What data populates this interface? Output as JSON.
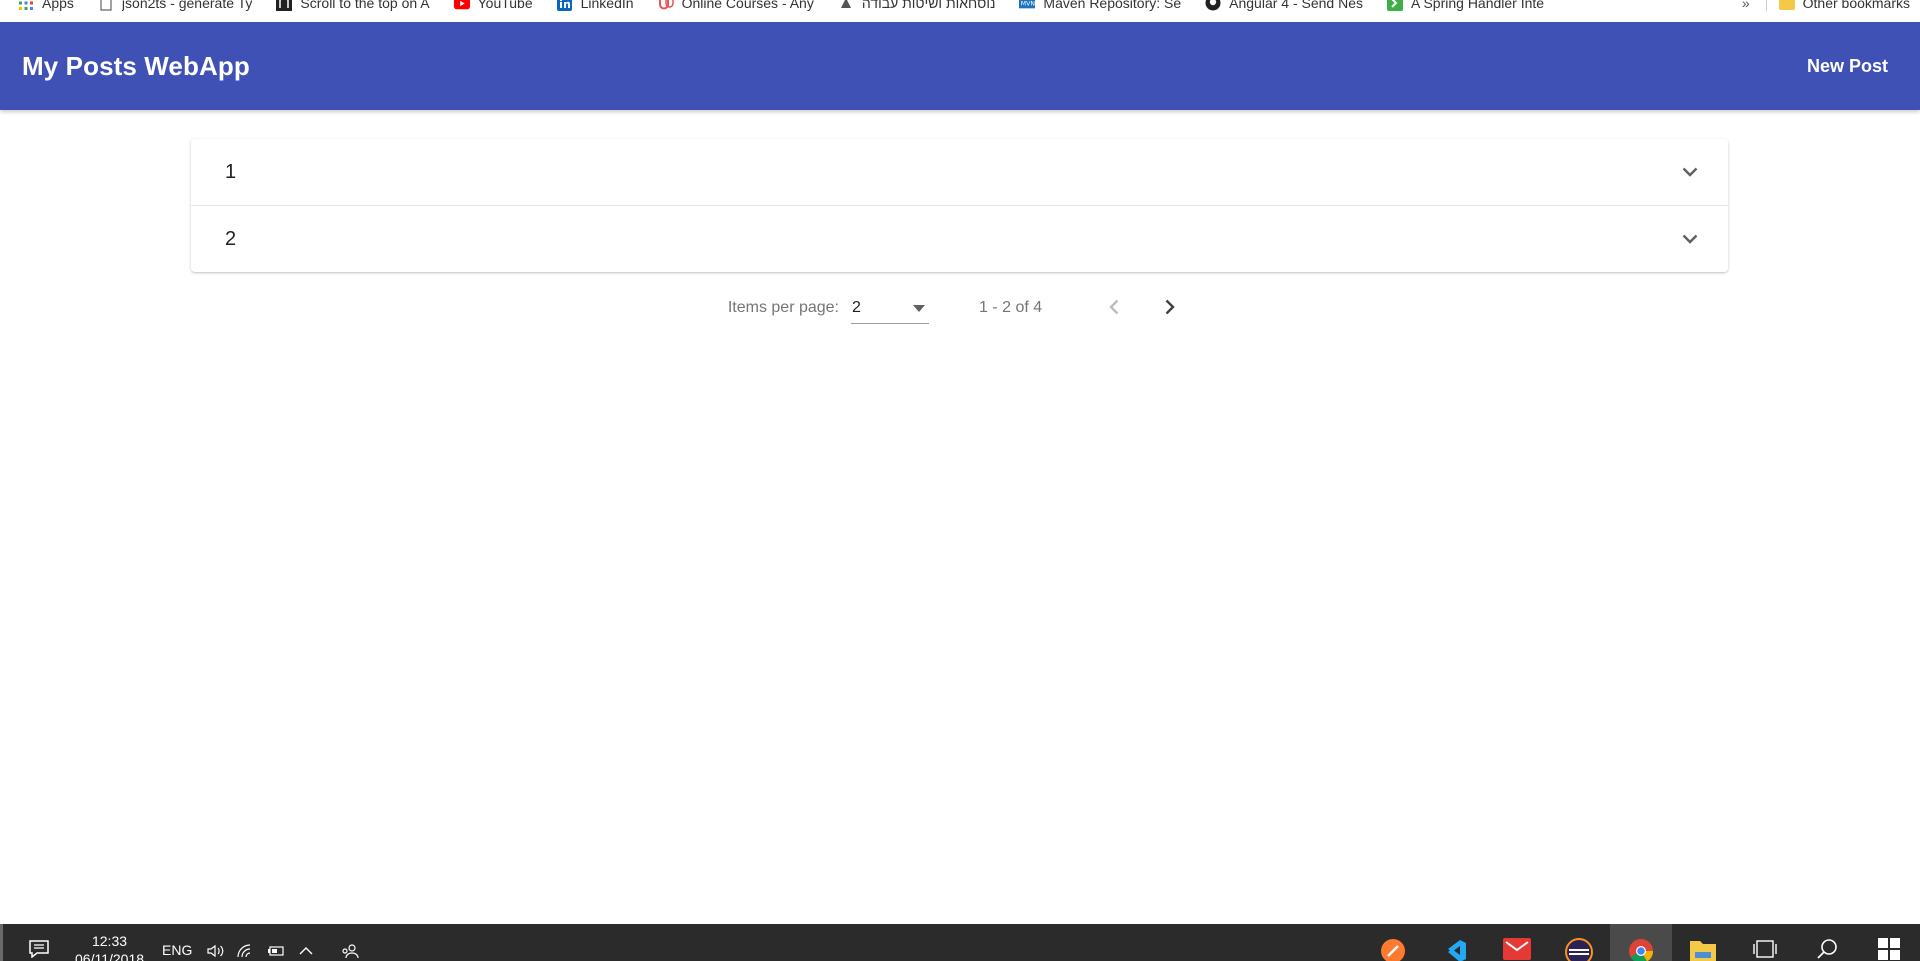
{
  "bookmarks": {
    "items": [
      {
        "label": "Apps",
        "icon": "apps-grid-icon"
      },
      {
        "label": "json2ts - generate Ty",
        "icon": "page-icon"
      },
      {
        "label": "Scroll to the top on A",
        "icon": "site-icon"
      },
      {
        "label": "YouTube",
        "icon": "youtube-icon"
      },
      {
        "label": "LinkedIn",
        "icon": "linkedin-icon"
      },
      {
        "label": "Online Courses - Any",
        "icon": "udemy-icon"
      },
      {
        "label": "נוסחאות ושיטות עבודה",
        "icon": "site-icon"
      },
      {
        "label": "Maven Repository: Se",
        "icon": "maven-icon"
      },
      {
        "label": "Angular 4 - Send Nes",
        "icon": "github-icon"
      },
      {
        "label": "A Spring Handler Inte",
        "icon": "site-icon"
      }
    ],
    "overflow": "»",
    "other_label": "Other bookmarks"
  },
  "toolbar": {
    "title": "My Posts WebApp",
    "new_post_label": "New Post",
    "color": "#3f51b5"
  },
  "accordion": {
    "panels": [
      {
        "title": "1"
      },
      {
        "title": "2"
      }
    ]
  },
  "paginator": {
    "items_per_page_label": "Items per page:",
    "page_size": "2",
    "range_label": "1 - 2 of 4"
  },
  "taskbar": {
    "time": "12:33",
    "date": "06/11/2018",
    "lang": "ENG",
    "apps": [
      "sublime-icon",
      "vscode-icon",
      "mail-icon",
      "eclipse-icon",
      "chrome-icon",
      "file-explorer-icon",
      "task-view-icon",
      "search-icon",
      "windows-start-icon"
    ]
  }
}
